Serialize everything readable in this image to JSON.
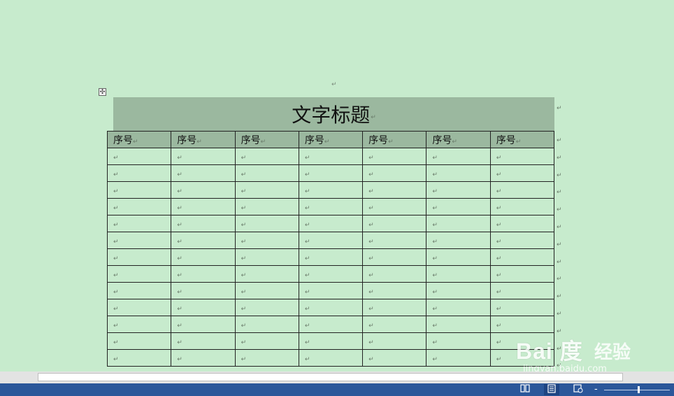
{
  "document": {
    "title": "文字标题",
    "paragraph_mark": "↵",
    "move_handle_glyph": "✣",
    "columns": [
      "序号",
      "序号",
      "序号",
      "序号",
      "序号",
      "序号",
      "序号"
    ],
    "empty_rows": 13
  },
  "watermark": {
    "brand": "Bai 度",
    "sub": "经验",
    "url": "jingyan.baidu.com"
  },
  "statusbar": {
    "view_buttons": [
      "read-mode",
      "print-layout",
      "web-layout"
    ],
    "zoom_minus": "-",
    "accent": "#2b579a"
  },
  "colors": {
    "page_bg": "#c7ebcd",
    "header_fill": "#9bb89f"
  }
}
